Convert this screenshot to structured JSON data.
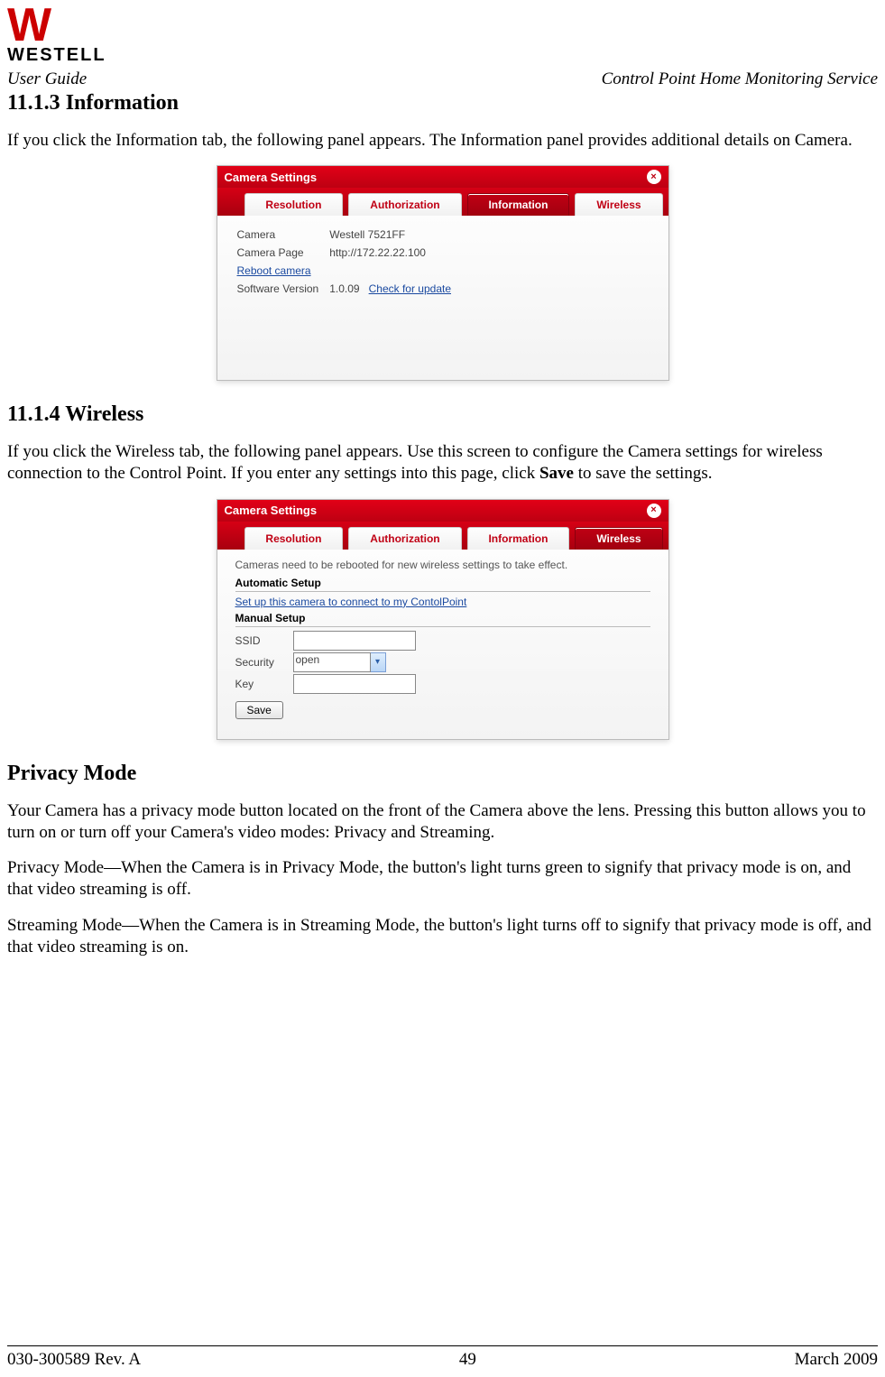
{
  "header": {
    "brand_w": "W",
    "brand_text": "WESTELL",
    "left": "User Guide",
    "right": "Control Point Home Monitoring Service"
  },
  "sections": {
    "s1_num": "11.1.3",
    "s1_title": "Information",
    "s1_para": "If you click the Information tab, the following panel appears. The Information panel provides additional details on Camera.",
    "s2_num": "11.1.4",
    "s2_title": "Wireless",
    "s2_para": "If you click the Wireless tab, the following panel appears. Use this screen to configure the Camera settings for wireless connection to the Control Point. If you enter any settings into this page, click ",
    "s2_para_bold": "Save",
    "s2_para_tail": " to save the settings.",
    "s3_title": " Privacy Mode",
    "s3_p1": "Your Camera has a privacy mode button located on the front of the Camera above the lens. Pressing this button allows you to turn on or turn off your Camera's video modes: Privacy and Streaming.",
    "s3_p2": "Privacy Mode—When the Camera is in Privacy Mode, the button's light turns green to signify that privacy mode is on, and that video streaming is off.",
    "s3_p3": "Streaming Mode—When the Camera is in Streaming Mode, the button's light turns off to signify that privacy mode is off, and that video streaming is on."
  },
  "panel_common": {
    "title": "Camera Settings",
    "close_glyph": "×",
    "tabs": [
      "Resolution",
      "Authorization",
      "Information",
      "Wireless"
    ]
  },
  "panel_info": {
    "active_tab_index": 2,
    "rows": {
      "camera_label": "Camera",
      "camera_value": "Westell 7521FF",
      "page_label": "Camera Page",
      "page_value": "http://172.22.22.100",
      "reboot_link": "Reboot camera",
      "sw_label": "Software Version",
      "sw_value": "1.0.09",
      "check_update": "Check for update"
    }
  },
  "panel_wireless": {
    "active_tab_index": 3,
    "note": "Cameras need to be rebooted for new wireless settings to take effect.",
    "auto_head": "Automatic Setup",
    "auto_link": "Set up this camera to connect to my ContolPoint",
    "manual_head": "Manual Setup",
    "ssid_label": "SSID",
    "ssid_value": "",
    "security_label": "Security",
    "security_value": "open",
    "key_label": "Key",
    "key_value": "",
    "save_label": "Save"
  },
  "footer": {
    "left": "030-300589 Rev. A",
    "center": "49",
    "right": "March 2009"
  }
}
